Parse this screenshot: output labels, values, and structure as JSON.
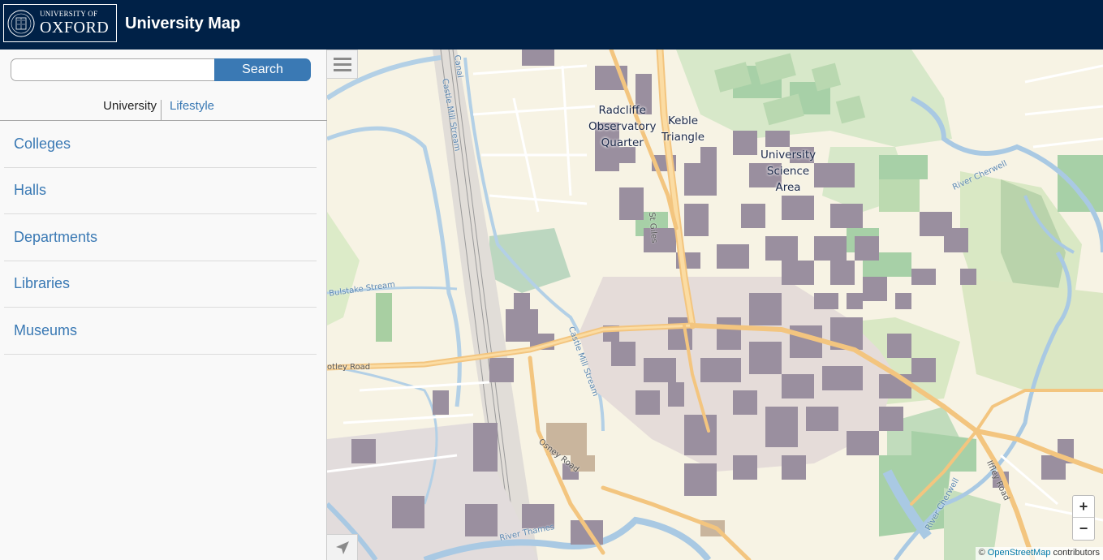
{
  "header": {
    "logo_top": "UNIVERSITY OF",
    "logo_main": "OXFORD",
    "app_title": "University Map"
  },
  "sidebar": {
    "search": {
      "value": "",
      "placeholder": "",
      "button_label": "Search"
    },
    "tabs": [
      {
        "label": "University",
        "active": true
      },
      {
        "label": "Lifestyle",
        "active": false
      }
    ],
    "categories": [
      {
        "label": "Colleges"
      },
      {
        "label": "Halls"
      },
      {
        "label": "Departments"
      },
      {
        "label": "Libraries"
      },
      {
        "label": "Museums"
      }
    ]
  },
  "map": {
    "area_labels": [
      {
        "line1": "Radcliffe",
        "line2": "Observatory",
        "line3": "Quarter"
      },
      {
        "line1": "Keble",
        "line2": "Triangle"
      },
      {
        "line1": "University",
        "line2": "Science",
        "line3": "Area"
      }
    ],
    "street_labels": {
      "st_giles": "St Giles",
      "botley": "otley Road",
      "osney": "Osney Road",
      "iffley": "Iffley Road"
    },
    "water_labels": {
      "castle_mill": "Castle Mill Stream",
      "castle_mill_2": "Castle Mill Stream",
      "bulstake": "Bulstake Stream",
      "thames": "River Thames",
      "cherwell": "River Cherwell",
      "cherwell_2": "River Cherwell",
      "canal": "Canal"
    },
    "zoom_in": "+",
    "zoom_out": "−",
    "attribution_prefix": "©",
    "attribution_link": "OpenStreetMap",
    "attribution_suffix": "contributors",
    "icons": [
      "menu-icon",
      "locate-arrow-icon",
      "university-crest-icon"
    ]
  },
  "colors": {
    "header_bg": "#002147",
    "accent": "#3a79b4",
    "water": "#b5d0e6",
    "park": "#cde6c4",
    "building": "#9d93a0",
    "road": "#f5c77e"
  }
}
